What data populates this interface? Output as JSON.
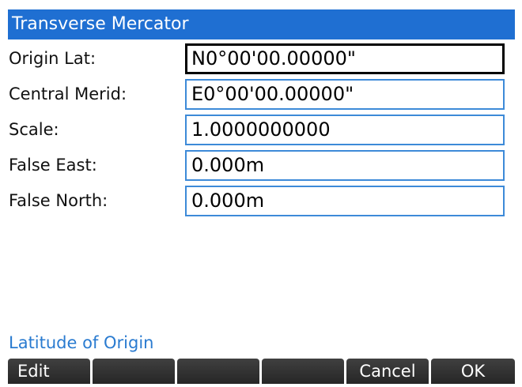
{
  "title": "Transverse Mercator",
  "fields": [
    {
      "label": "Origin Lat:",
      "value": "N0°00'00.00000\""
    },
    {
      "label": "Central Merid:",
      "value": "E0°00'00.00000\""
    },
    {
      "label": "Scale:",
      "value": "1.0000000000"
    },
    {
      "label": "False East:",
      "value": "0.000m"
    },
    {
      "label": "False North:",
      "value": "0.000m"
    }
  ],
  "help_text": "Latitude of Origin",
  "softkeys": [
    "Edit",
    "",
    "",
    "",
    "Cancel",
    "OK"
  ],
  "colors": {
    "title_bar": "#1f6fd2",
    "field_border": "#3d8ad8",
    "focused_border": "#000000",
    "help_text": "#2a7bd0",
    "softkey_bg": "#333333"
  }
}
